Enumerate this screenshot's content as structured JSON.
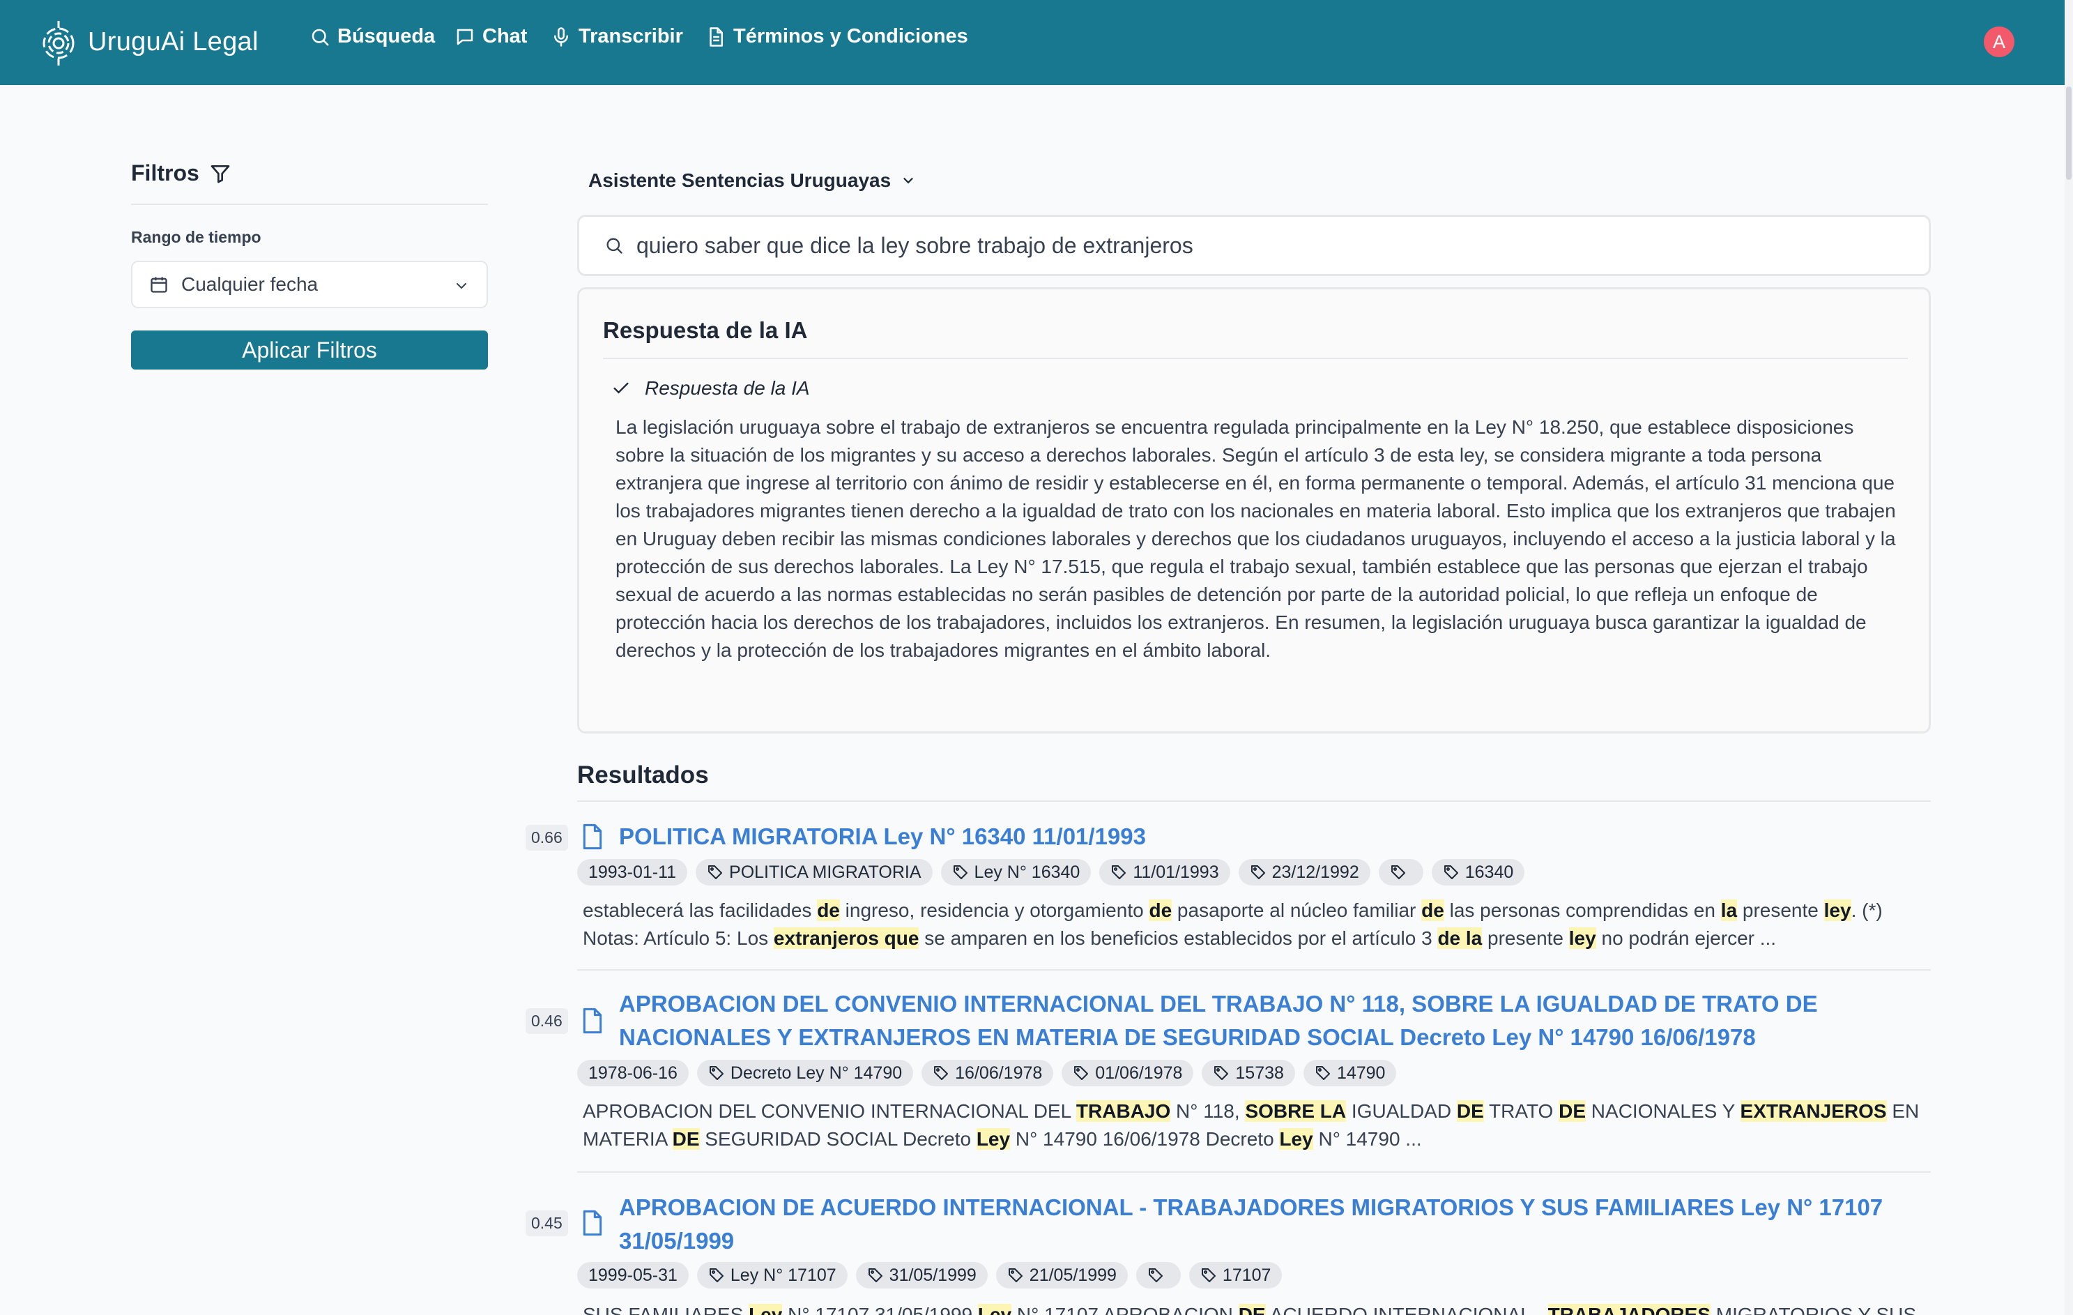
{
  "app": {
    "name": "UruguAi Legal",
    "nav": [
      {
        "label": "Búsqueda",
        "icon": "search-icon"
      },
      {
        "label": "Chat",
        "icon": "chat-icon"
      },
      {
        "label": "Transcribir",
        "icon": "microphone-icon"
      },
      {
        "label": "Términos y Condiciones",
        "icon": "document-icon"
      }
    ],
    "user_initial": "A"
  },
  "colors": {
    "primary": "#17788f",
    "link": "#3b7fd4",
    "highlight": "#fdf5b3",
    "avatar": "#f25a6b"
  },
  "filters": {
    "title": "Filtros",
    "range_label": "Rango de tiempo",
    "date_value": "Cualquier fecha",
    "apply_label": "Aplicar Filtros"
  },
  "assistant": {
    "selected": "Asistente Sentencias Uruguayas"
  },
  "search": {
    "query": "quiero saber que dice la ley sobre trabajo de extranjeros"
  },
  "ai_answer": {
    "title": "Respuesta de la IA",
    "subtitle": "Respuesta de la IA",
    "text": "La legislación uruguaya sobre el trabajo de extranjeros se encuentra regulada principalmente en la Ley N° 18.250, que establece disposiciones sobre la situación de los migrantes y su acceso a derechos laborales. Según el artículo 3 de esta ley, se considera migrante a toda persona extranjera que ingrese al territorio con ánimo de residir y establecerse en él, en forma permanente o temporal. Además, el artículo 31 menciona que los trabajadores migrantes tienen derecho a la igualdad de trato con los nacionales en materia laboral. Esto implica que los extranjeros que trabajen en Uruguay deben recibir las mismas condiciones laborales y derechos que los ciudadanos uruguayos, incluyendo el acceso a la justicia laboral y la protección de sus derechos laborales. La Ley N° 17.515, que regula el trabajo sexual, también establece que las personas que ejerzan el trabajo sexual de acuerdo a las normas establecidas no serán pasibles de detención por parte de la autoridad policial, lo que refleja un enfoque de protección hacia los derechos de los trabajadores, incluidos los extranjeros. En resumen, la legislación uruguaya busca garantizar la igualdad de derechos y la protección de los trabajadores migrantes en el ámbito laboral."
  },
  "results": {
    "title": "Resultados",
    "items": [
      {
        "score": "0.66",
        "title": "POLITICA MIGRATORIA Ley N° 16340 11/01/1993",
        "date": "1993-01-11",
        "tags": [
          "POLITICA MIGRATORIA",
          "Ley N° 16340",
          "11/01/1993",
          "23/12/1992",
          "",
          "16340"
        ],
        "snippet": [
          {
            "t": "establecerá las facilidades "
          },
          {
            "t": "de",
            "h": true
          },
          {
            "t": " ingreso, residencia y otorgamiento "
          },
          {
            "t": "de",
            "h": true
          },
          {
            "t": " pasaporte al núcleo familiar "
          },
          {
            "t": "de",
            "h": true
          },
          {
            "t": " las personas comprendidas en "
          },
          {
            "t": "la",
            "h": true
          },
          {
            "t": " presente "
          },
          {
            "t": "ley",
            "h": true
          },
          {
            "t": ". (*) Notas: Artículo 5: Los "
          },
          {
            "t": "extranjeros que",
            "h": true
          },
          {
            "t": " se amparen en los beneficios establecidos por el artículo 3 "
          },
          {
            "t": "de la",
            "h": true
          },
          {
            "t": " presente "
          },
          {
            "t": "ley",
            "h": true
          },
          {
            "t": " no podrán ejercer ..."
          }
        ]
      },
      {
        "score": "0.46",
        "title": "APROBACION DEL CONVENIO INTERNACIONAL DEL TRABAJO N° 118, SOBRE LA IGUALDAD DE TRATO DE NACIONALES Y EXTRANJEROS EN MATERIA DE SEGURIDAD SOCIAL Decreto Ley N° 14790 16/06/1978",
        "date": "1978-06-16",
        "tags": [
          "Decreto Ley N° 14790",
          "16/06/1978",
          "01/06/1978",
          "15738",
          "14790"
        ],
        "snippet": [
          {
            "t": "APROBACION DEL CONVENIO INTERNACIONAL DEL "
          },
          {
            "t": "TRABAJO",
            "h": true
          },
          {
            "t": " N° 118, "
          },
          {
            "t": "SOBRE LA",
            "h": true
          },
          {
            "t": " IGUALDAD "
          },
          {
            "t": "DE",
            "h": true
          },
          {
            "t": " TRATO "
          },
          {
            "t": "DE",
            "h": true
          },
          {
            "t": " NACIONALES Y "
          },
          {
            "t": "EXTRANJEROS",
            "h": true
          },
          {
            "t": " EN MATERIA "
          },
          {
            "t": "DE",
            "h": true
          },
          {
            "t": " SEGURIDAD SOCIAL Decreto "
          },
          {
            "t": "Ley",
            "h": true
          },
          {
            "t": " N° 14790 16/06/1978 Decreto "
          },
          {
            "t": "Ley",
            "h": true
          },
          {
            "t": " N° 14790 ..."
          }
        ]
      },
      {
        "score": "0.45",
        "title": "APROBACION DE ACUERDO INTERNACIONAL - TRABAJADORES MIGRATORIOS Y SUS FAMILIARES Ley N° 17107 31/05/1999",
        "date": "1999-05-31",
        "tags": [
          "Ley N° 17107",
          "31/05/1999",
          "21/05/1999",
          "",
          "17107"
        ],
        "snippet": [
          {
            "t": "SUS FAMILIARES "
          },
          {
            "t": "Ley",
            "h": true
          },
          {
            "t": " N° 17107 31/05/1999 "
          },
          {
            "t": "Ley",
            "h": true
          },
          {
            "t": " N° 17107 APROBACION "
          },
          {
            "t": "DE",
            "h": true
          },
          {
            "t": " ACUERDO INTERNACIONAL - "
          },
          {
            "t": "TRABAJADORES",
            "h": true
          },
          {
            "t": " MIGRATORIOS Y SUS ..."
          }
        ]
      }
    ]
  }
}
